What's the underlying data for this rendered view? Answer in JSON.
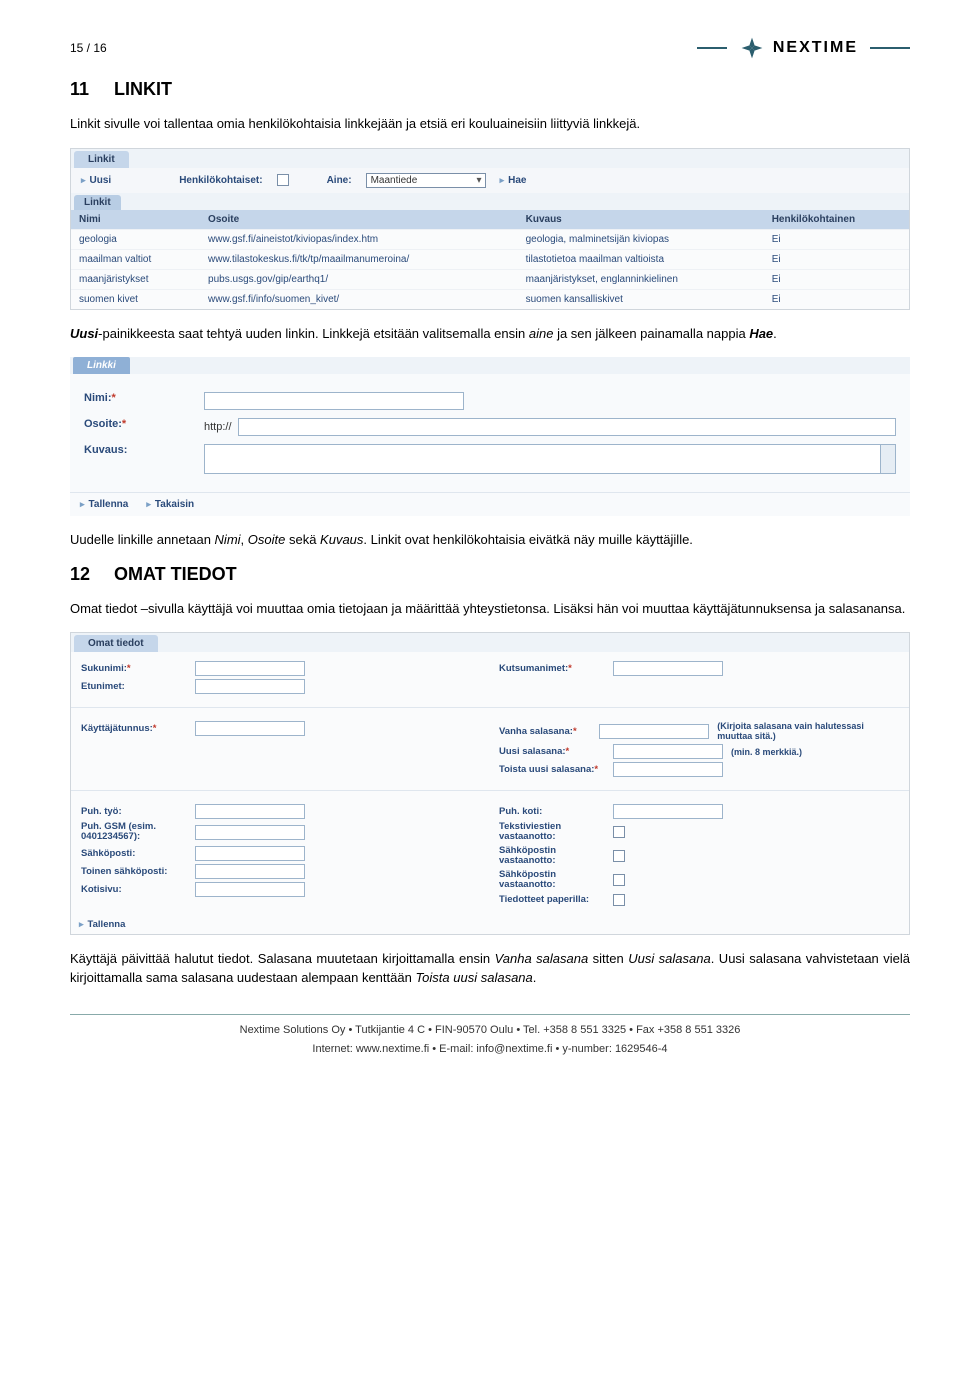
{
  "pagenum": "15 / 16",
  "brand": "NEXTIME",
  "h11_num": "11",
  "h11_title": "LINKIT",
  "p11_intro": "Linkit sivulle voi tallentaa omia henkilökohtaisia linkkejään ja etsiä eri kouluaineisiin liittyviä linkkejä.",
  "panel_link": {
    "tab": "Linkit",
    "btn_new": "Uusi",
    "lbl_personal": "Henkilökohtaiset:",
    "lbl_subject": "Aine:",
    "select_subject_value": "Maantiede",
    "btn_search": "Hae",
    "list_tab": "Linkit",
    "headers": [
      "Nimi",
      "Osoite",
      "Kuvaus",
      "Henkilökohtainen"
    ],
    "rows": [
      [
        "geologia",
        "www.gsf.fi/aineistot/kiviopas/index.htm",
        "geologia, malminetsijän kiviopas",
        "Ei"
      ],
      [
        "maailman valtiot",
        "www.tilastokeskus.fi/tk/tp/maailmanumeroina/",
        "tilastotietoa maailman valtioista",
        "Ei"
      ],
      [
        "maanjäristykset",
        "pubs.usgs.gov/gip/earthq1/",
        "maanjäristykset, englanninkielinen",
        "Ei"
      ],
      [
        "suomen kivet",
        "www.gsf.fi/info/suomen_kivet/",
        "suomen kansalliskivet",
        "Ei"
      ]
    ]
  },
  "p11_mid": "Uusi-painikkeesta saat tehtyä uuden linkin. Linkkejä etsitään valitsemalla ensin aine ja sen jälkeen painamalla nappia Hae.",
  "panel_newlink": {
    "tab": "Linkki",
    "lbl_name": "Nimi:",
    "lbl_addr": "Osoite:",
    "http": "http://",
    "lbl_desc": "Kuvaus:",
    "btn_save": "Tallenna",
    "btn_back": "Takaisin"
  },
  "p11_after": "Uudelle linkille annetaan Nimi, Osoite sekä Kuvaus. Linkit ovat henkilökohtaisia eivätkä näy muille käyttäjille.",
  "h12_num": "12",
  "h12_title": "OMAT TIEDOT",
  "p12_intro": "Omat tiedot –sivulla käyttäjä voi muuttaa omia tietojaan ja määrittää yhteystietonsa. Lisäksi hän voi muuttaa käyttäjätunnuksensa ja salasanansa.",
  "panel_ot": {
    "tab": "Omat tiedot",
    "left": {
      "sukunimi": "Sukunimi:",
      "etunimet": "Etunimet:",
      "kayttajatunnus": "Käyttäjätunnus:",
      "puh_tyo": "Puh. työ:",
      "puh_gsm": "Puh. GSM (esim. 0401234567):",
      "sahkoposti": "Sähköposti:",
      "toinen_sahkoposti": "Toinen sähköposti:",
      "kotisivu": "Kotisivu:"
    },
    "right": {
      "kutsumanimet": "Kutsumanimet:",
      "vanha_salasana": "Vanha salasana:",
      "uusi_salasana": "Uusi salasana:",
      "toista": "Toista uusi salasana:",
      "hint_vanha": "(Kirjoita salasana vain halutessasi muuttaa sitä.)",
      "hint_uusi": "(min. 8 merkkiä.)",
      "puh_koti": "Puh. koti:",
      "tekstiviestien": "Tekstiviestien vastaanotto:",
      "sahkopostin1": "Sähköpostin vastaanotto:",
      "sahkopostin2": "Sähköpostin vastaanotto:",
      "tiedotteet": "Tiedotteet paperilla:"
    },
    "btn_save": "Tallenna"
  },
  "p12_after": "Käyttäjä päivittää halutut tiedot. Salasana muutetaan kirjoittamalla ensin Vanha salasana sitten Uusi salasana. Uusi salasana vahvistetaan vielä kirjoittamalla sama salasana uudestaan alempaan kenttään Toista uusi salasana.",
  "footer1": "Nextime Solutions Oy • Tutkijantie 4 C • FIN-90570 Oulu • Tel. +358 8 551 3325 • Fax +358 8 551 3326",
  "footer2": "Internet: www.nextime.fi • E-mail: info@nextime.fi • y-number: 1629546-4"
}
